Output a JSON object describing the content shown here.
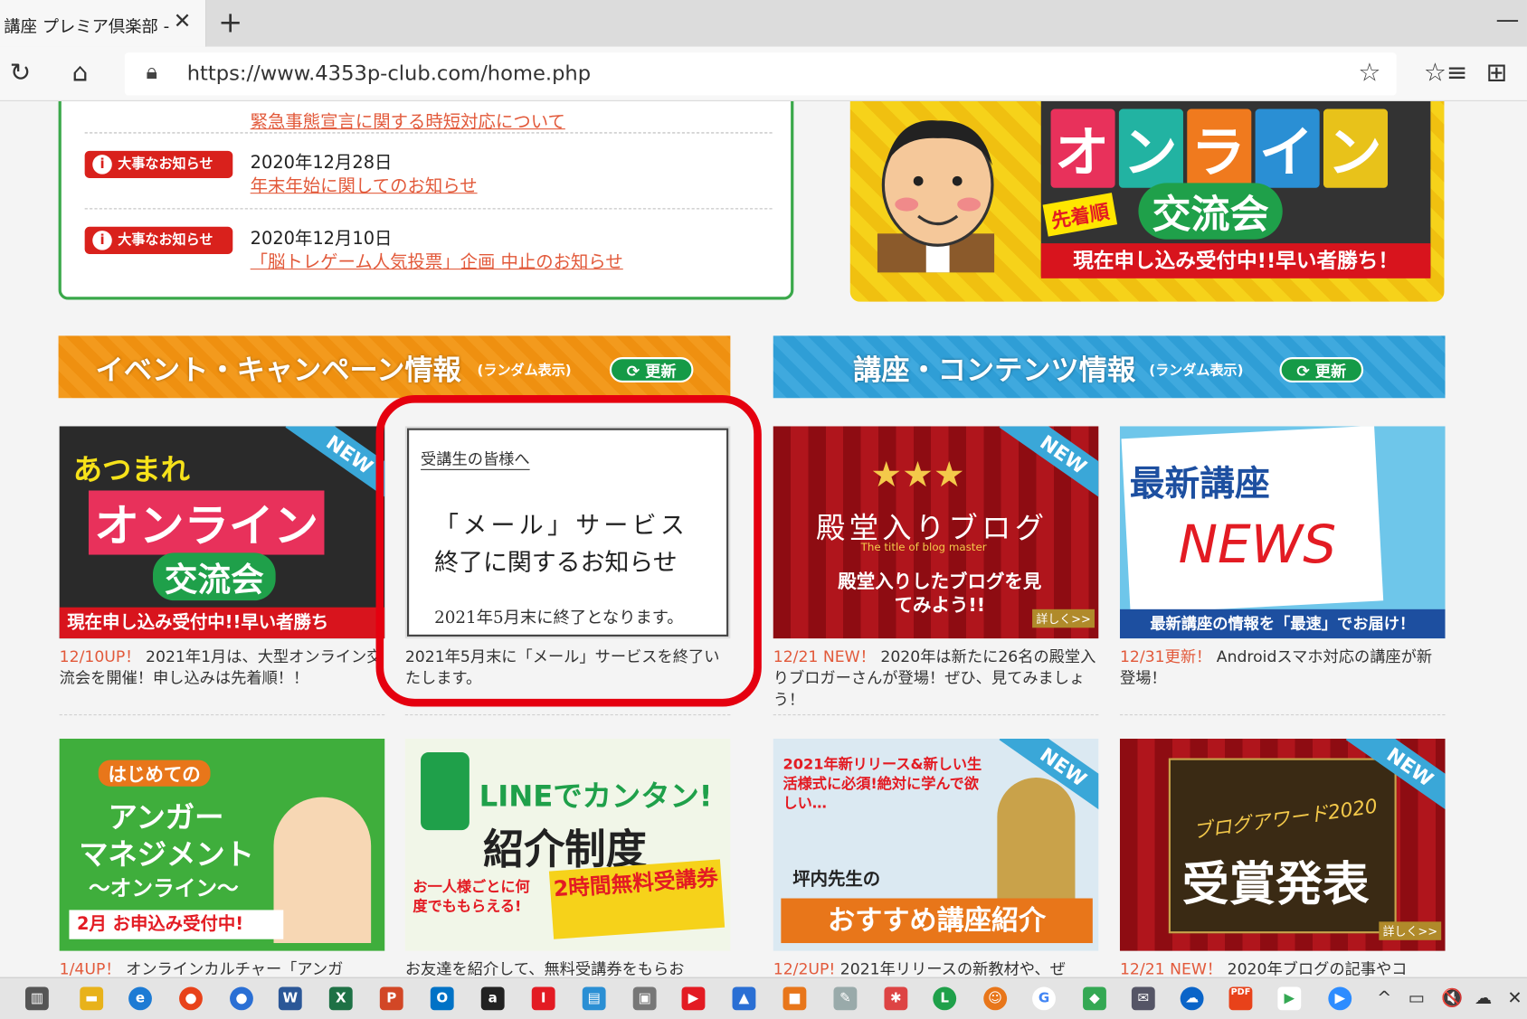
{
  "browser": {
    "tab_title": "講座 プレミア倶楽部 -",
    "tab_close": "✕",
    "new_tab": "+",
    "url": "https://www.4353p-club.com/home.php",
    "minimize": "—"
  },
  "news": {
    "top_link": "緊急事態宣言に関する時短対応について",
    "items": [
      {
        "badge": "大事なお知らせ",
        "date": "2020年12月28日",
        "link": "年末年始に関してのお知らせ"
      },
      {
        "badge": "大事なお知らせ",
        "date": "2020年12月10日",
        "link": "「脳トレゲーム人気投票」企画 中止のお知らせ"
      }
    ]
  },
  "banner": {
    "title_chars": [
      "オ",
      "ン",
      "ラ",
      "イ",
      "ン"
    ],
    "sub": "交流会",
    "senchaku": "先着順",
    "foot": "現在申し込み受付中!!早い者勝ち！"
  },
  "sections": {
    "events": {
      "title": "イベント・キャンペーン情報",
      "random": "(ランダム表示)",
      "update": "更新",
      "color": "#f39a1d"
    },
    "courses": {
      "title": "講座・コンテンツ情報",
      "random": "(ランダム表示)",
      "update": "更新",
      "color": "#3fa9de"
    }
  },
  "cards": {
    "c1": {
      "img_text1": "あつまれ",
      "img_text2": "オンライン",
      "img_text3": "交流会",
      "img_foot": "現在申し込み受付中!!早い者勝ち",
      "badge": "NEW",
      "date": "12/10UP！",
      "text": "2021年1月は、大型オンライン交流会を開催！申し込みは先着順！！"
    },
    "c2": {
      "n_head": "受講生の皆様へ",
      "n_m1": "「メール」サービス",
      "n_m2": "終了に関するお知らせ",
      "n_m3": "2021年5月末に終了となります。",
      "text": "2021年5月末に「メール」サービスを終了いたします。"
    },
    "c3": {
      "stars": "★★★",
      "img_title": "殿堂入りブログ",
      "img_sub": "The title of blog master",
      "img_text": "殿堂入りしたブログを見てみよう!!",
      "more": "詳しく>>",
      "badge": "NEW",
      "date": "12/21 NEW！",
      "text": "2020年は新たに26名の殿堂入りブロガーさんが登場！ぜひ、見てみましょう！"
    },
    "c4": {
      "img_title": "最新講座",
      "img_news": "NEWS",
      "img_foot": "最新講座の情報を「最速」でお届け！",
      "date": "12/31更新！",
      "text": "Androidスマホ対応の講座が新登場！"
    },
    "c5": {
      "img_label": "はじめての",
      "img_title1": "アンガー",
      "img_title2": "マネジメント",
      "img_title3": "〜オンライン〜",
      "img_foot": "2月 お申込み受付中!",
      "date": "1/4UP！",
      "text": "オンラインカルチャー「アンガ"
    },
    "c6": {
      "img_title1": "LINEでカンタン!",
      "img_title2": "紹介制度",
      "img_side": "お一人様ごとに何度でももらえる!",
      "img_ticket": "2時間無料受講券",
      "text": "お友達を紹介して、無料受講券をもらお"
    },
    "c7": {
      "img_top": "2021年新リリース&新しい生活様式に必須!絶対に学んで欲しい…",
      "img_name": "坪内先生の",
      "img_title": "おすすめ講座紹介",
      "badge": "NEW",
      "date": "12/2UP!",
      "text": "2021年リリースの新教材や、ぜ"
    },
    "c8": {
      "img_title1": "ブログアワード2020",
      "img_title2": "受賞発表",
      "more": "詳しく>>",
      "badge": "NEW",
      "date": "12/21 NEW！",
      "text": "2020年ブログの記事やコ"
    }
  },
  "taskbar": {
    "apps": [
      "task-view",
      "file-explorer",
      "edge",
      "chrome",
      "people",
      "word",
      "excel",
      "powerpoint",
      "outlook",
      "amazon",
      "iris",
      "news",
      "computer",
      "youtube",
      "photos",
      "paint3d",
      "paint",
      "fan",
      "line",
      "mascot",
      "google",
      "maps",
      "mail-tray",
      "onedrive",
      "pdf",
      "play",
      "zoom"
    ],
    "tray": [
      "^",
      "▭",
      "🔇",
      "☁",
      "✕"
    ]
  }
}
